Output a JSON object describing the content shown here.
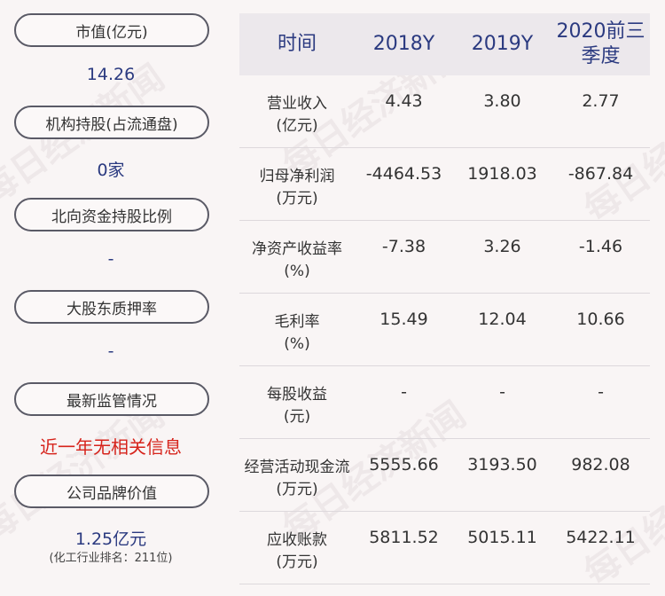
{
  "left_panel": [
    {
      "label": "市值(亿元)",
      "value": "14.26"
    },
    {
      "label": "机构持股(占流通盘)",
      "value": "0家"
    },
    {
      "label": "北向资金持股比例",
      "value": "-"
    },
    {
      "label": "大股东质押率",
      "value": "-"
    },
    {
      "label": "最新监管情况",
      "value": "近一年无相关信息"
    },
    {
      "label": "公司品牌价值",
      "value": "1.25亿元",
      "note": "(化工行业排名：211位)"
    }
  ],
  "table": {
    "headers": [
      "时间",
      "2018Y",
      "2019Y",
      "2020前三季度"
    ],
    "rows": [
      {
        "label": [
          "营业收入",
          "(亿元)"
        ],
        "values": [
          "4.43",
          "3.80",
          "2.77"
        ]
      },
      {
        "label": [
          "归母净利润",
          "(万元)"
        ],
        "values": [
          "-4464.53",
          "1918.03",
          "-867.84"
        ]
      },
      {
        "label": [
          "净资产收益率",
          "(%)"
        ],
        "values": [
          "-7.38",
          "3.26",
          "-1.46"
        ]
      },
      {
        "label": [
          "毛利率",
          "(%)"
        ],
        "values": [
          "15.49",
          "12.04",
          "10.66"
        ]
      },
      {
        "label": [
          "每股收益",
          "(元)"
        ],
        "values": [
          "-",
          "-",
          "-"
        ]
      },
      {
        "label": [
          "经营活动现金流",
          "(万元)"
        ],
        "values": [
          "5555.66",
          "3193.50",
          "982.08"
        ]
      },
      {
        "label": [
          "应收账款",
          "(万元)"
        ],
        "values": [
          "5811.52",
          "5015.11",
          "5422.11"
        ]
      }
    ]
  },
  "watermark": "每日经济新闻"
}
